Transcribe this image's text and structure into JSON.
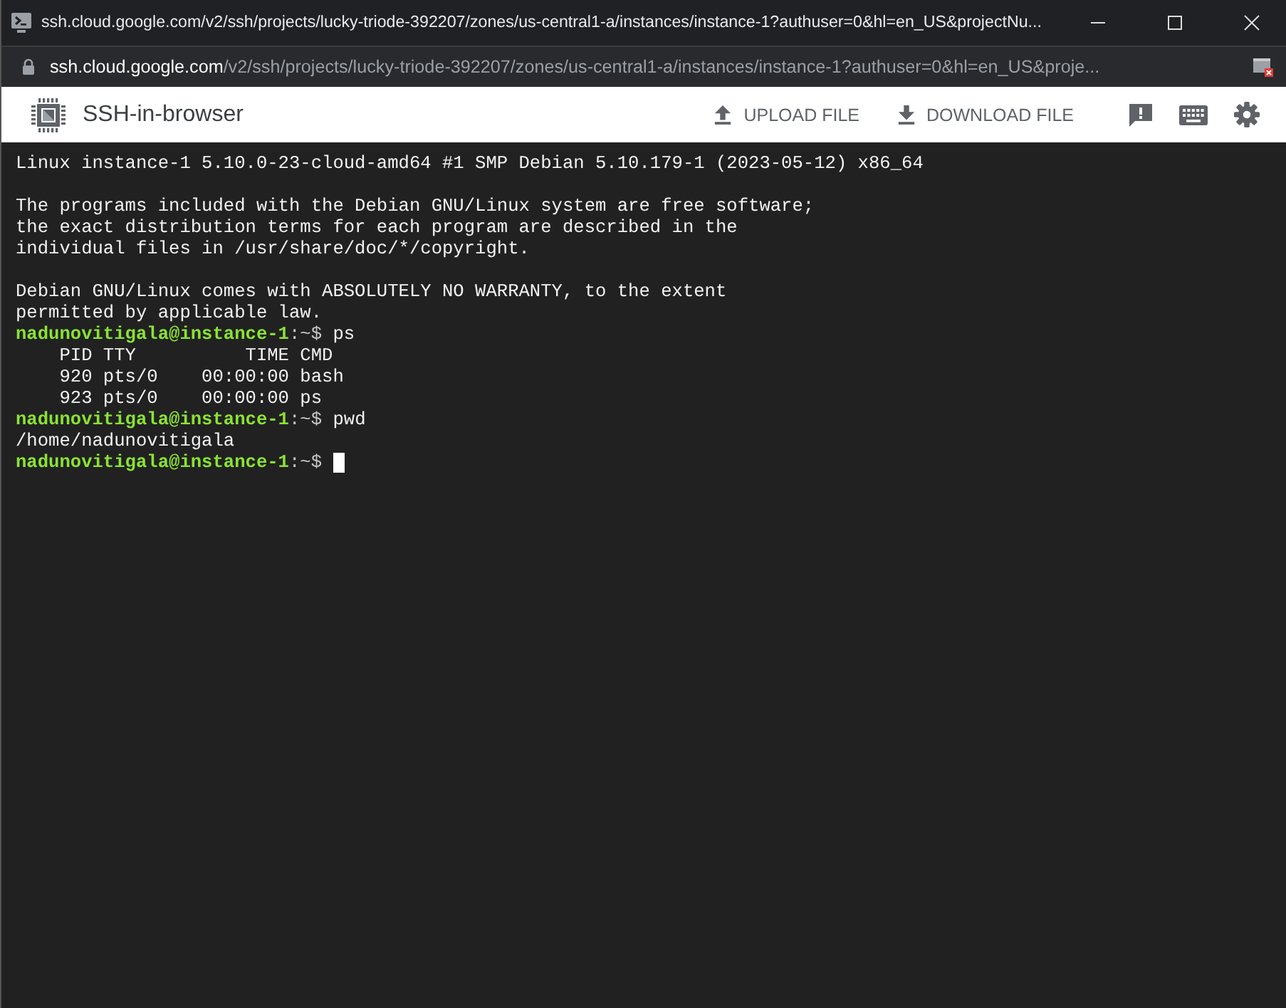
{
  "window": {
    "title": "ssh.cloud.google.com/v2/ssh/projects/lucky-triode-392207/zones/us-central1-a/instances/instance-1?authuser=0&hl=en_US&projectNu..."
  },
  "address_bar": {
    "host": "ssh.cloud.google.com",
    "path": "/v2/ssh/projects/lucky-triode-392207/zones/us-central1-a/instances/instance-1?authuser=0&hl=en_US&proje..."
  },
  "toolbar": {
    "title": "SSH-in-browser",
    "actions": [
      {
        "kind": "upload",
        "label": "UPLOAD FILE"
      },
      {
        "kind": "download",
        "label": "DOWNLOAD FILE"
      },
      {
        "kind": "feedback"
      },
      {
        "kind": "keyboard"
      },
      {
        "kind": "settings"
      }
    ]
  },
  "terminal": {
    "lines": [
      {
        "kind": "output",
        "text": "Linux instance-1 5.10.0-23-cloud-amd64 #1 SMP Debian 5.10.179-1 (2023-05-12) x86_64"
      },
      {
        "kind": "blank"
      },
      {
        "kind": "output",
        "text": "The programs included with the Debian GNU/Linux system are free software;"
      },
      {
        "kind": "output",
        "text": "the exact distribution terms for each program are described in the"
      },
      {
        "kind": "output",
        "text": "individual files in /usr/share/doc/*/copyright."
      },
      {
        "kind": "blank"
      },
      {
        "kind": "output",
        "text": "Debian GNU/Linux comes with ABSOLUTELY NO WARRANTY, to the extent"
      },
      {
        "kind": "output",
        "text": "permitted by applicable law."
      },
      {
        "kind": "prompt",
        "user": "nadunovitigala@instance-1",
        "path": ":~$",
        "command": "ps",
        "cursor": false
      },
      {
        "kind": "output",
        "text": "    PID TTY          TIME CMD"
      },
      {
        "kind": "output",
        "text": "    920 pts/0    00:00:00 bash"
      },
      {
        "kind": "output",
        "text": "    923 pts/0    00:00:00 ps"
      },
      {
        "kind": "prompt",
        "user": "nadunovitigala@instance-1",
        "path": ":~$",
        "command": "pwd",
        "cursor": false
      },
      {
        "kind": "output",
        "text": "/home/nadunovitigala"
      },
      {
        "kind": "prompt",
        "user": "nadunovitigala@instance-1",
        "path": ":~$",
        "cursor": true
      }
    ]
  }
}
